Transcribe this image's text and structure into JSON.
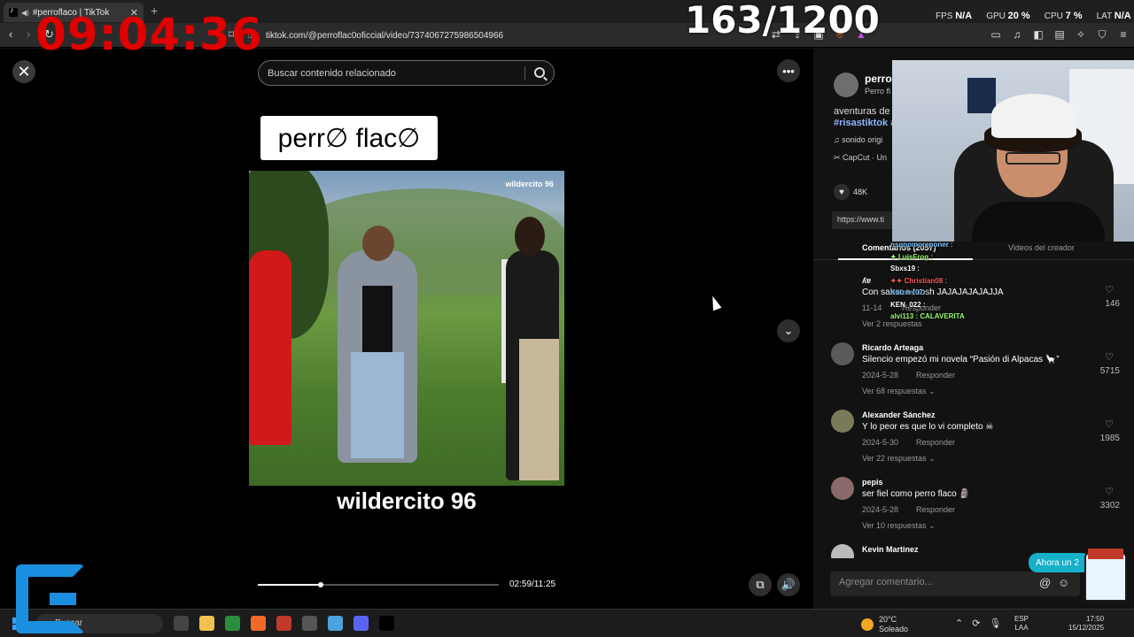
{
  "browser": {
    "tab_title": "#perroflaco | TikTok",
    "url": "tiktok.com/@perroflac0oficcial/video/7374067275986504966"
  },
  "overlay": {
    "clock": "09:04:36",
    "counter": "163/1200",
    "fps_label": "FPS",
    "fps_value": "N/A",
    "gpu_label": "GPU",
    "gpu_value": "20 %",
    "cpu_label": "CPU",
    "cpu_value": "7 %",
    "lat_label": "LAT",
    "lat_value": "N/A"
  },
  "video": {
    "search_placeholder": "Buscar contenido relacionado",
    "brand_text": "perr∅ flac∅",
    "watermark": "wildercito 96",
    "caption": "wildercito 96",
    "time": "02:59/11:25",
    "progress": 0.26
  },
  "panel": {
    "author_name": "perro",
    "author_sub": "Perro fl",
    "description": "aventuras de",
    "tags": "#risastiktok #",
    "sound": "sonido origi",
    "capcut": "CapCut · Un",
    "likes": "48K",
    "link": "https://www.ti",
    "tab_comments": "Comentarios (2057)",
    "tab_creator": "Videos del creador",
    "comments": [
      {
        "name": "ʎɐ",
        "text": "Con sabor a toosh JAJAJAJAJAJJA",
        "date": "11-14",
        "reply": "Responder",
        "more": "Ver 2 respuestas",
        "likes": "146"
      },
      {
        "name": "Ricardo Arteaga",
        "text": "Silencio empezó mi novela “Pasión di Alpacas 🦙”",
        "date": "2024-5-28",
        "reply": "Responder",
        "more": "Ver 68 respuestas ⌄",
        "likes": "5715"
      },
      {
        "name": "Alexander Sánchez",
        "text": "Y lo peor es que lo vi completo ☠",
        "date": "2024-5-30",
        "reply": "Responder",
        "more": "Ver 22 respuestas ⌄",
        "likes": "1985"
      },
      {
        "name": "pepis",
        "text": "ser fiel como perro flaco 🗿",
        "date": "2024-5-28",
        "reply": "Responder",
        "more": "Ver 10 respuestas ⌄",
        "likes": "3302"
      },
      {
        "name": "Kevin Martinez",
        "text": "",
        "date": "",
        "reply": "",
        "more": "",
        "likes": ""
      }
    ],
    "add_comment_placeholder": "Agregar comentario...",
    "ahora_label": "Ahora un 2"
  },
  "chat": [
    {
      "user": "nsgnomoreponer :",
      "color": "#7ec8ff"
    },
    {
      "user": "✦ LuisFrog :",
      "color": "#9aff6e"
    },
    {
      "user": "Sbxs19 :",
      "color": "#ffffff"
    },
    {
      "user": "✦✦ Christian08 :",
      "color": "#ff5a5a"
    },
    {
      "user": "Kaizen 07 :",
      "color": "#7ec8ff"
    },
    {
      "user": "KEN_022 :",
      "color": "#ffffff"
    },
    {
      "user": "alvi113 : CALAVERITA",
      "color": "#9aff6e"
    }
  ],
  "taskbar": {
    "search": "Buscar",
    "temp": "20°C",
    "weather": "Soleado",
    "lang1": "ESP",
    "lang2": "LAA",
    "time": "17:50",
    "date": "15/12/2025"
  }
}
